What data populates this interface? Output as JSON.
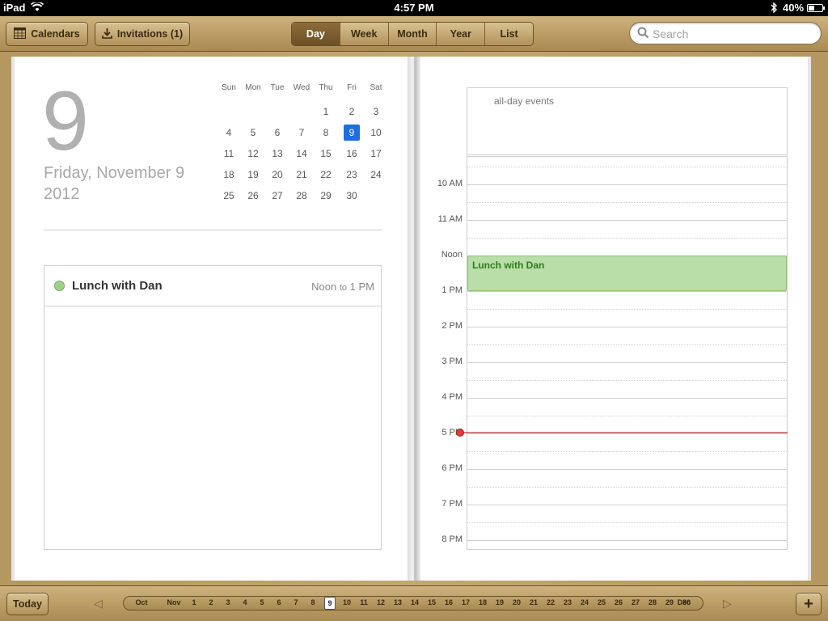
{
  "status": {
    "carrier": "iPad",
    "time": "4:57 PM",
    "battery": "40%",
    "battery_fraction": 0.4
  },
  "toolbar": {
    "calendars_label": "Calendars",
    "invitations_label": "Invitations (1)",
    "views": [
      "Day",
      "Week",
      "Month",
      "Year",
      "List"
    ],
    "active_view": "Day",
    "search_placeholder": "Search"
  },
  "day_page": {
    "day_number": "9",
    "date_line1": "Friday, November 9",
    "date_line2": "2012",
    "minical": {
      "weekdays": [
        "Sun",
        "Mon",
        "Tue",
        "Wed",
        "Thu",
        "Fri",
        "Sat"
      ],
      "weeks": [
        [
          "",
          "",
          "",
          "",
          "1",
          "2",
          "3"
        ],
        [
          "4",
          "5",
          "6",
          "7",
          "8",
          "9",
          "10"
        ],
        [
          "11",
          "12",
          "13",
          "14",
          "15",
          "16",
          "17"
        ],
        [
          "18",
          "19",
          "20",
          "21",
          "22",
          "23",
          "24"
        ],
        [
          "25",
          "26",
          "27",
          "28",
          "29",
          "30",
          ""
        ]
      ],
      "selected": "9"
    },
    "events": [
      {
        "title": "Lunch with Dan",
        "start": "Noon",
        "to": "to",
        "end": "1 PM",
        "color": "#9ed28c"
      }
    ]
  },
  "timeline": {
    "all_day_label": "all-day events",
    "hours": [
      "10 AM",
      "11 AM",
      "Noon",
      "1 PM",
      "2 PM",
      "3 PM",
      "4 PM",
      "5 PM",
      "6 PM",
      "7 PM",
      "8 PM"
    ],
    "event_title": "Lunch with Dan",
    "event_color": "#b9dea8",
    "now_color": "#e03c3c"
  },
  "bottombar": {
    "today_label": "Today",
    "prev_month": "Oct",
    "current_month": "Nov",
    "next_month": "Dec",
    "days": [
      "1",
      "2",
      "3",
      "4",
      "5",
      "6",
      "7",
      "8",
      "9",
      "10",
      "11",
      "12",
      "13",
      "14",
      "15",
      "16",
      "17",
      "18",
      "19",
      "20",
      "21",
      "22",
      "23",
      "24",
      "25",
      "26",
      "27",
      "28",
      "29",
      "30"
    ],
    "selected_day": "9"
  }
}
